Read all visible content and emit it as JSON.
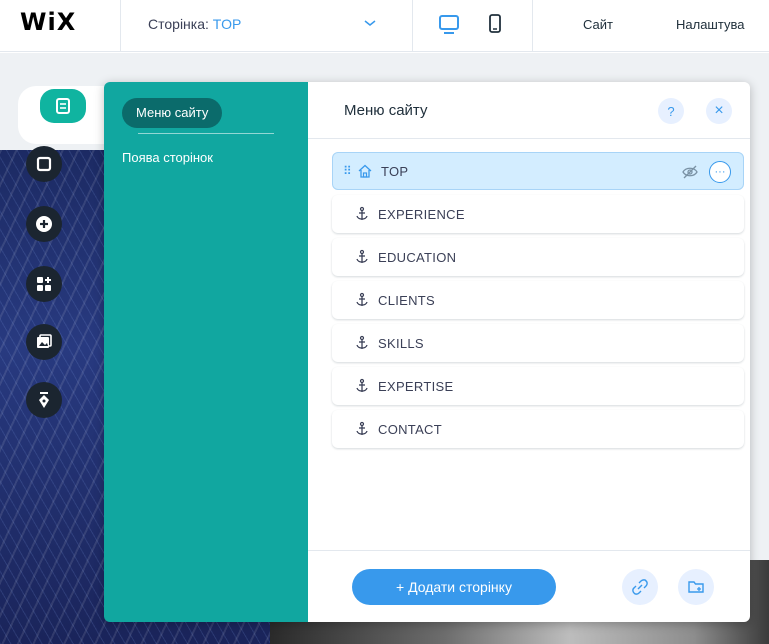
{
  "topbar": {
    "logo": "WiX",
    "page_label": "Сторінка: ",
    "page_value": "TOP",
    "site_menu": "Сайт",
    "settings_menu": "Налаштува"
  },
  "rail": {
    "icons": [
      "pages-icon",
      "background-icon",
      "add-icon",
      "add-apps-icon",
      "media-icon",
      "blog-icon"
    ]
  },
  "panel": {
    "categories": [
      "Меню сайту",
      "Поява сторінок"
    ],
    "title": "Меню сайту",
    "help_label": "?",
    "close_label": "×",
    "pages": [
      {
        "label": "TOP",
        "type": "home",
        "selected": true
      },
      {
        "label": "EXPERIENCE",
        "type": "anchor"
      },
      {
        "label": "EDUCATION",
        "type": "anchor"
      },
      {
        "label": "CLIENTS",
        "type": "anchor"
      },
      {
        "label": "SKILLS",
        "type": "anchor"
      },
      {
        "label": "EXPERTISE",
        "type": "anchor"
      },
      {
        "label": "CONTACT",
        "type": "anchor"
      }
    ],
    "add_page_button": "+ Додати сторінку",
    "more_label": "···"
  },
  "colors": {
    "accent_blue": "#3899ec",
    "panel_teal": "#11a7a0",
    "active_teal": "#0b6b6b",
    "rail_dark": "#1b2530"
  }
}
